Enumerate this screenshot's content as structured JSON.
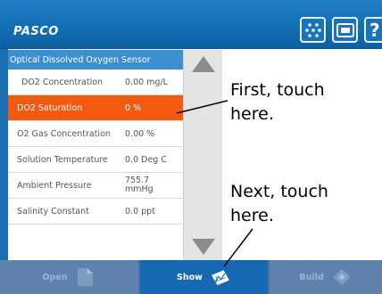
{
  "header": {
    "logo_text": "PASCO",
    "buttons": [
      {
        "icon": "dots-icon"
      },
      {
        "icon": "meter-icon"
      },
      {
        "label": "?"
      }
    ]
  },
  "sensor_panel": {
    "title": "Optical Dissolved Oxygen Sensor",
    "rows": [
      {
        "label": "DO2 Concentration",
        "value": "0.00 mg/L"
      },
      {
        "label": "DO2 Saturation",
        "value": "0 %",
        "selected": true
      },
      {
        "label": "O2 Gas Concentration",
        "value": "0.00 %"
      },
      {
        "label": "Solution Temperature",
        "value": "0.0 Deg C"
      },
      {
        "label": "Ambient Pressure",
        "value_line1": "755.7",
        "value_line2": "mmHg"
      },
      {
        "label": "Salinity Constant",
        "value": "0.0 ppt"
      }
    ]
  },
  "annotations": {
    "first": "First, touch here.",
    "next": "Next, touch here."
  },
  "bottom_bar": {
    "tabs": [
      {
        "label": "Open",
        "icon": "open-icon"
      },
      {
        "label": "Show",
        "icon": "show-graph-icon",
        "active": true
      },
      {
        "label": "Build",
        "icon": "build-icon"
      }
    ]
  },
  "colors": {
    "header": "#1a74bb",
    "selected_row": "#f25a12",
    "panel_title": "#3b8fcf",
    "bottom_active": "#1668b3"
  }
}
